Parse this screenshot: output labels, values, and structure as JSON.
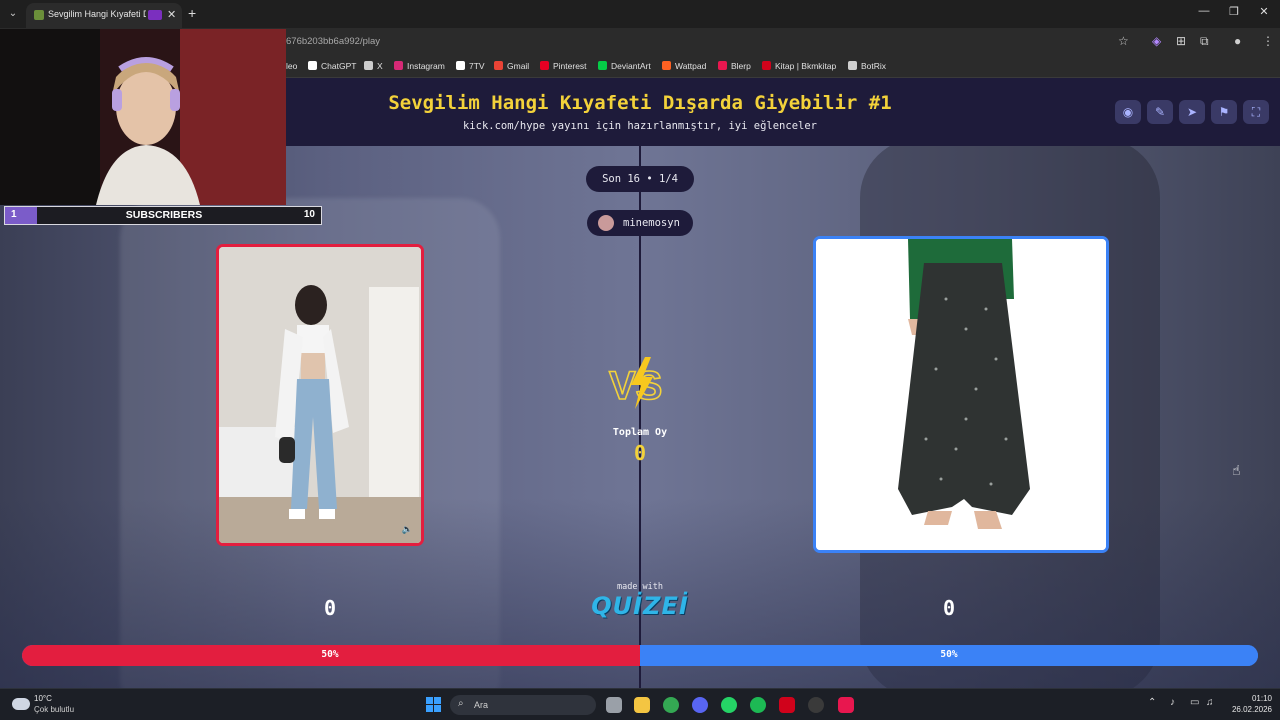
{
  "browser": {
    "tab_title": "Sevgilim Hangi Kıyafeti Dış",
    "url": "676b203bb6a992/play",
    "bookmarks": [
      {
        "label": "leo",
        "color": "#e53935"
      },
      {
        "label": "ChatGPT",
        "color": "#ffffff"
      },
      {
        "label": "X",
        "color": "#cccccc"
      },
      {
        "label": "Instagram",
        "color": "#d62976"
      },
      {
        "label": "7TV",
        "color": "#ffffff"
      },
      {
        "label": "Gmail",
        "color": "#ea4335"
      },
      {
        "label": "Pinterest",
        "color": "#e60023"
      },
      {
        "label": "DeviantArt",
        "color": "#05cc47"
      },
      {
        "label": "Wattpad",
        "color": "#ff6122"
      },
      {
        "label": "Blerp",
        "color": "#e8174f"
      },
      {
        "label": "Kitap | Bkmkitap",
        "color": "#d0021b"
      },
      {
        "label": "BotRix",
        "color": "#cfcfcf"
      }
    ]
  },
  "header": {
    "title": "Sevgilim Hangi Kıyafeti Dışarda Giyebilir #1",
    "subtitle": "kick.com/hype yayını için hazırlanmıştır, iyi eğlenceler",
    "buttons": [
      "eye-icon",
      "edit-icon",
      "share-icon",
      "flag-icon",
      "fullscreen-icon"
    ]
  },
  "game": {
    "round": "Son 16 • 1/4",
    "creator": "minemosyn",
    "total_label": "Toplam Oy",
    "total_value": "0",
    "left": {
      "score": "0",
      "percent": "50%",
      "percent_value": 50
    },
    "right": {
      "score": "0",
      "percent": "50%",
      "percent_value": 50
    },
    "made_with": "made with",
    "brand": "QUIZEI",
    "colors": {
      "left": "#e31e3f",
      "right": "#3b82f6",
      "accent": "#f3d23a",
      "header_bg": "#1e1b3a"
    }
  },
  "overlay": {
    "sub_count": "1",
    "sub_label": "SUBSCRIBERS",
    "sub_goal": "10",
    "sub_progress": 0.1
  },
  "taskbar": {
    "temp": "10°C",
    "weather": "Çok bulutlu",
    "search_placeholder": "Ara",
    "time": "01:10",
    "date": "26.02.2026"
  }
}
